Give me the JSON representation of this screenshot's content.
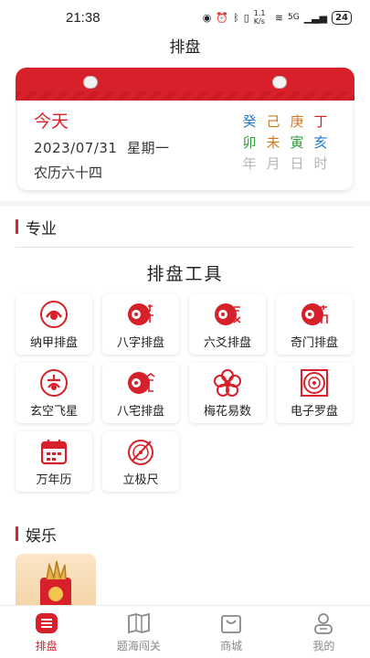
{
  "status": {
    "time": "21:38",
    "net": "1.1 K/s",
    "signal": "5G",
    "battery": "24"
  },
  "header": {
    "title": "排盘"
  },
  "calendar": {
    "today": "今天",
    "date": "2023/07/31",
    "weekday": "星期一",
    "lunar": "农历六十四",
    "ganzhi_row1": [
      "癸",
      "己",
      "庚",
      "丁"
    ],
    "ganzhi_row2": [
      "卯",
      "未",
      "寅",
      "亥"
    ],
    "ganzhi_row3": [
      "年",
      "月",
      "日",
      "时"
    ]
  },
  "sections": {
    "pro": "专业",
    "tools": "排盘工具",
    "fun": "娱乐"
  },
  "tools": [
    {
      "label": "纳甲排盘",
      "icon": "najia-icon"
    },
    {
      "label": "八字排盘",
      "icon": "bazi-icon"
    },
    {
      "label": "六爻排盘",
      "icon": "liuyao-icon"
    },
    {
      "label": "奇门排盘",
      "icon": "qimen-icon"
    },
    {
      "label": "玄空飞星",
      "icon": "xuankong-icon"
    },
    {
      "label": "八宅排盘",
      "icon": "bazhai-icon"
    },
    {
      "label": "梅花易数",
      "icon": "plum-blossom-icon"
    },
    {
      "label": "电子罗盘",
      "icon": "compass-icon"
    },
    {
      "label": "万年历",
      "icon": "calendar-icon"
    },
    {
      "label": "立极尺",
      "icon": "ruler-icon"
    }
  ],
  "tabs": [
    {
      "label": "排盘",
      "icon": "paipan-icon",
      "active": true
    },
    {
      "label": "题海闯关",
      "icon": "book-icon",
      "active": false
    },
    {
      "label": "商城",
      "icon": "shopping-bag-icon",
      "active": false
    },
    {
      "label": "我的",
      "icon": "profile-icon",
      "active": false
    }
  ],
  "colors": {
    "accent": "#d7202a",
    "blue": "#1f7bd1",
    "orange": "#c97a1e",
    "green": "#2f9a3a",
    "gray": "#b6b6b6"
  }
}
